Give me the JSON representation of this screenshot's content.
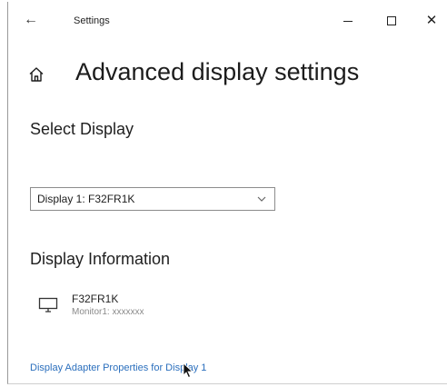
{
  "window": {
    "title": "Settings",
    "back_glyph": "←",
    "close_glyph": "✕"
  },
  "page": {
    "title": "Advanced display settings"
  },
  "select_display": {
    "heading": "Select Display",
    "dropdown_value": "Display 1:  F32FR1K"
  },
  "display_information": {
    "heading": "Display Information",
    "monitor_name": "F32FR1K",
    "monitor_desc": "Monitor1:  xxxxxxx"
  },
  "links": {
    "adapter_properties": "Display Adapter Properties for Display 1"
  },
  "icons": {
    "back": "back-arrow-icon",
    "home": "home-icon",
    "minimize": "minimize-icon",
    "maximize": "maximize-icon",
    "close": "close-icon",
    "chevron": "chevron-down-icon",
    "monitor": "monitor-icon",
    "cursor": "mouse-cursor-icon"
  },
  "colors": {
    "link": "#2b6fbd",
    "text": "#1c1c1c",
    "secondary_text": "#8a8a8a",
    "background": "#ffffff"
  }
}
